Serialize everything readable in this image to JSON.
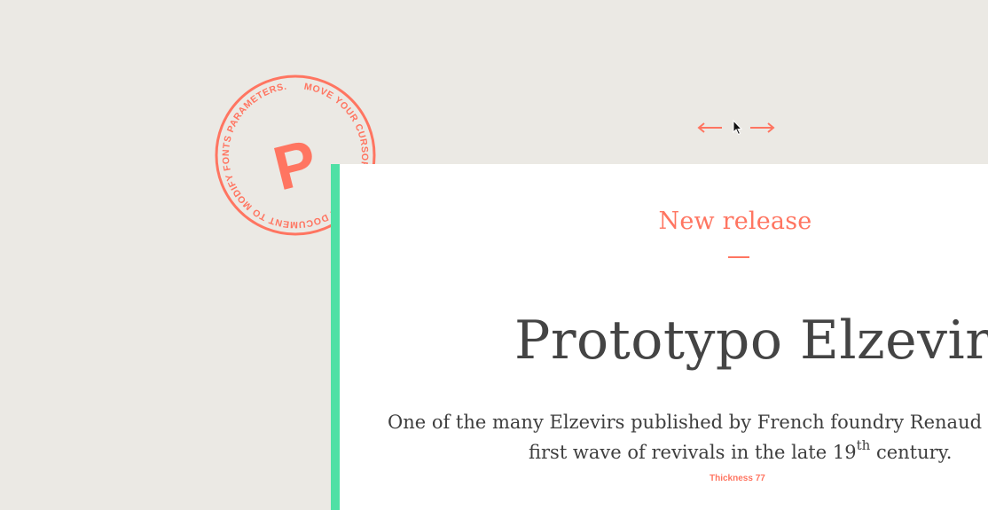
{
  "stamp": {
    "letter": "P",
    "circular_text": "MOVE YOUR CURSOR OVER THE DOCUMENT TO MODIFY FONTS PARAMETERS.",
    "color": "#ff7561"
  },
  "article": {
    "kicker": "New release",
    "title": "Prototypo Elzevir",
    "description_line1": "One of the many Elzevirs published by French foundry Renaud",
    "description_line2_pre": "first wave of revivals in the late 19",
    "description_line2_sup": "th",
    "description_line2_post": " century."
  },
  "parameter_indicator": "Thickness 77",
  "colors": {
    "accent": "#ff7561",
    "green_bar": "#4fe0a5",
    "background": "#ebe9e4",
    "document": "#ffffff",
    "text": "#444444"
  },
  "icons": [
    "arrow-left-icon",
    "arrow-right-icon",
    "cursor-icon",
    "stamp-logo-icon"
  ]
}
